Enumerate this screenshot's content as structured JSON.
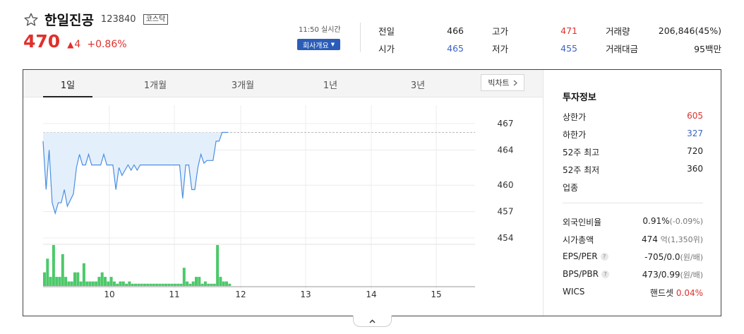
{
  "stock": {
    "name": "한일진공",
    "code": "123840",
    "market": "코스닥",
    "price": "470",
    "change_arrow": "▲",
    "change": "4",
    "change_pct": "+0.86%",
    "realtime": "11:50 실시간",
    "company_button": "회사개요"
  },
  "quotes": {
    "prev_close_label": "전일",
    "prev_close": "466",
    "open_label": "시가",
    "open": "465",
    "high_label": "고가",
    "high": "471",
    "low_label": "저가",
    "low": "455",
    "volume_label": "거래량",
    "volume": "206,846(45%)",
    "amount_label": "거래대금",
    "amount": "95백만"
  },
  "tabs": [
    "1일",
    "1개월",
    "3개월",
    "1년",
    "3년"
  ],
  "active_tab": "1일",
  "big_chart_label": "빅차트",
  "info": {
    "title": "투자정보",
    "upper_limit_label": "상한가",
    "upper_limit": "605",
    "lower_limit_label": "하한가",
    "lower_limit": "327",
    "high52_label": "52주 최고",
    "high52": "720",
    "low52_label": "52주 최저",
    "low52": "360",
    "industry_label": "업종",
    "foreign_label": "외국인비율",
    "foreign_value": "0.91%",
    "foreign_change": "(-0.09%)",
    "mcap_label": "시가총액",
    "mcap_value": "474",
    "mcap_unit": "억",
    "mcap_extra": "(1,350위)",
    "eps_label": "EPS/PER",
    "eps_value": "-705/0.0",
    "eps_unit": "(원/배)",
    "bps_label": "BPS/PBR",
    "bps_value": "473/0.99",
    "bps_unit": "(원/배)",
    "wics_label": "WICS",
    "wics_value": "핸드셋",
    "wics_pct": "0.04%"
  },
  "colors": {
    "up": "#e0302c",
    "down": "#3a63c4",
    "line": "#4a8fe0",
    "fill": "#e4effc",
    "volume": "#4cc96a",
    "badge": "#2a5db8"
  },
  "chart_data": {
    "type": "line",
    "x_ticks": [
      "10",
      "11",
      "12",
      "13",
      "14",
      "15"
    ],
    "y_ticks": [
      467,
      464,
      460,
      457,
      454
    ],
    "prev_close": 466,
    "price": [
      465,
      459.5,
      464,
      458,
      456.8,
      458,
      458,
      459.5,
      457.6,
      458.3,
      459,
      462,
      463.5,
      462.3,
      462.3,
      463.5,
      462.3,
      462.3,
      462.3,
      462.3,
      463.5,
      462.3,
      462.3,
      462.3,
      459.5,
      462,
      461.1,
      461.7,
      462.3,
      461.7,
      462.3,
      461.7,
      462.3,
      462.3,
      462.3,
      462.3,
      462.3,
      462.3,
      462.3,
      462.3,
      462.3,
      462.3,
      462.3,
      462.3,
      462.3,
      462.3,
      458.5,
      462.3,
      462.3,
      459.5,
      459.5,
      462,
      463.5,
      462.5,
      462.8,
      462.8,
      462.8,
      465,
      465,
      466,
      466,
      466
    ],
    "volume": [
      3,
      6,
      2,
      9,
      2,
      2,
      7,
      2,
      1,
      1,
      3,
      3,
      1,
      5,
      1,
      1,
      1,
      1,
      2,
      3,
      2,
      1,
      2,
      1,
      0.5,
      1,
      1,
      0.5,
      1,
      0.5,
      0.5,
      0.5,
      0.5,
      0.5,
      0.5,
      0.5,
      0.5,
      0.5,
      0.5,
      0.5,
      0.5,
      0.5,
      0.5,
      0.5,
      0.5,
      0.5,
      4,
      1,
      0.5,
      1,
      2,
      2,
      0.5,
      1,
      0.5,
      0.5,
      0.5,
      9,
      2,
      1,
      1,
      0.5
    ]
  }
}
